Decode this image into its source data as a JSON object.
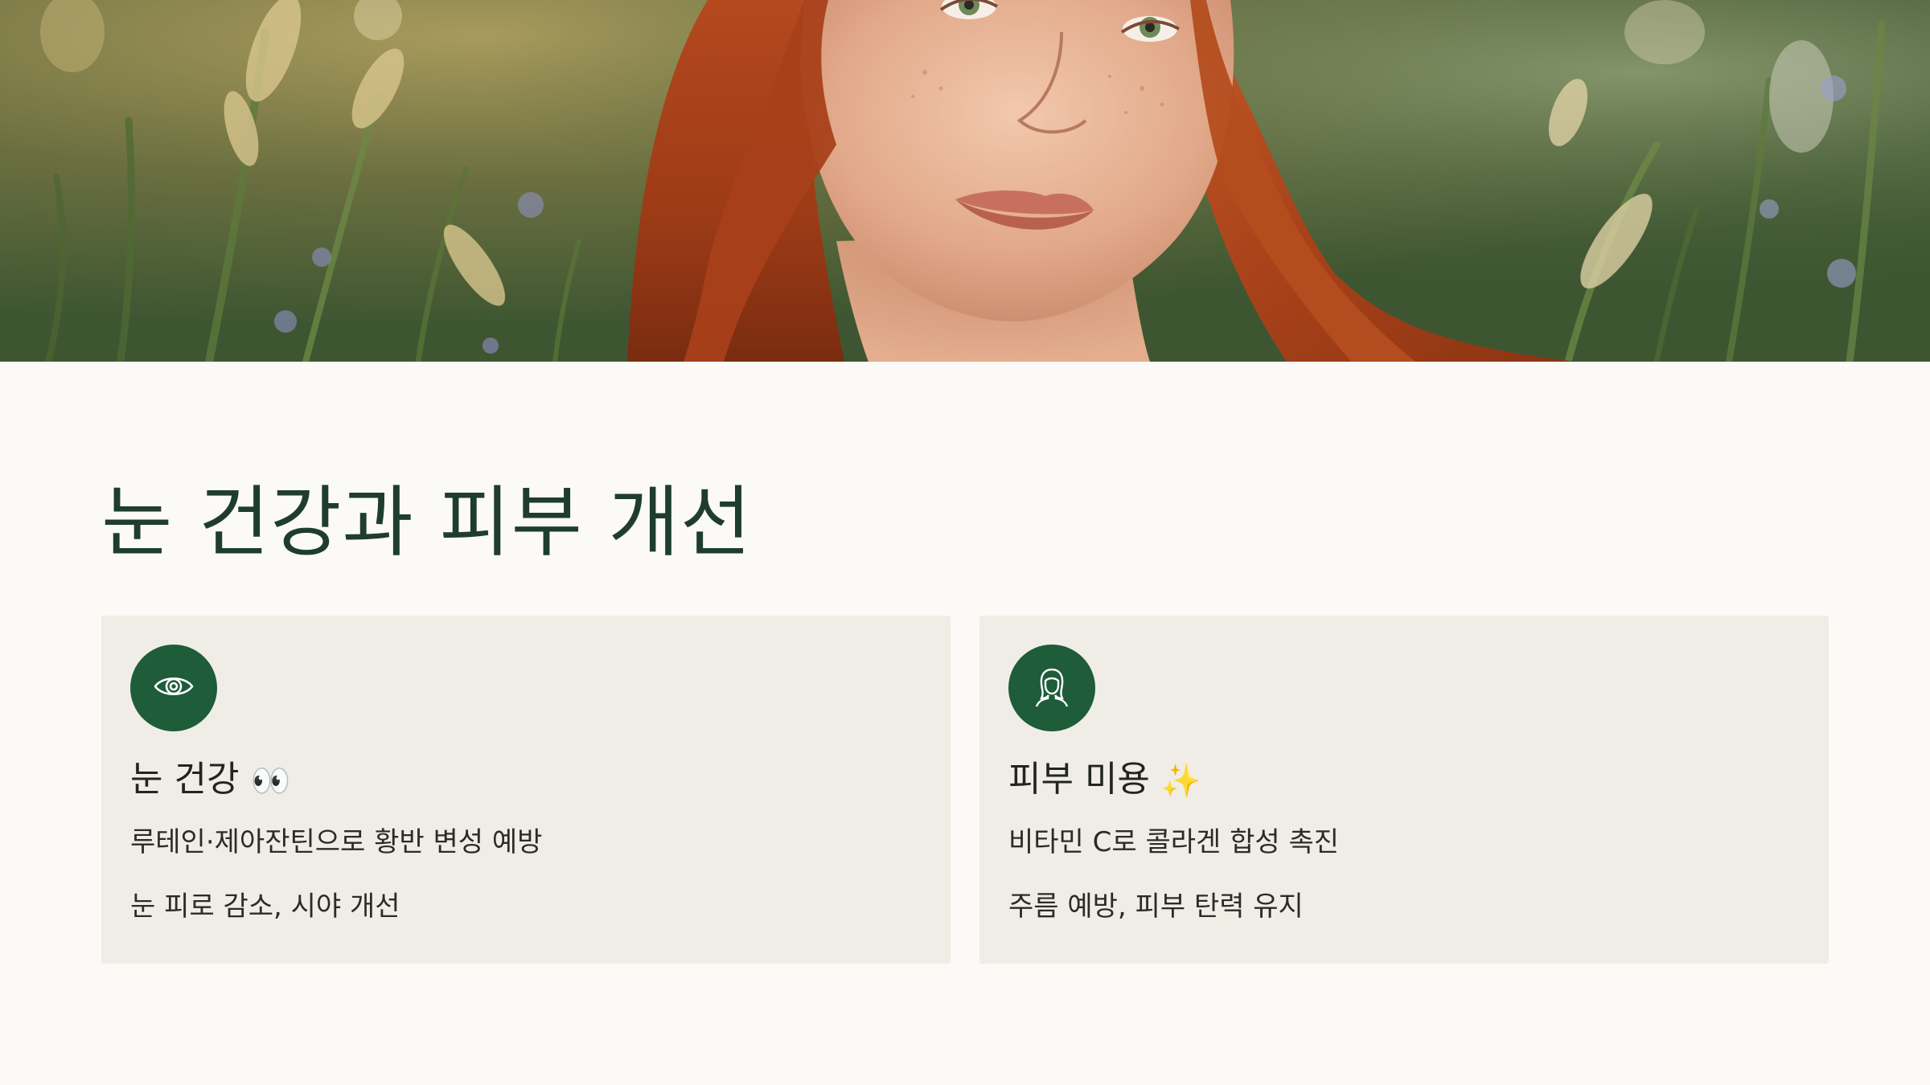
{
  "hero": {
    "image": "portrait-photo"
  },
  "section": {
    "title": "눈 건강과 피부 개선"
  },
  "cards": [
    {
      "icon": "eye-icon",
      "title": "눈 건강",
      "emoji": "👀",
      "lines": [
        "루테인·제아잔틴으로 황반 변성 예방",
        "눈 피로 감소, 시야 개선"
      ]
    },
    {
      "icon": "woman-face-icon",
      "title": "피부 미용",
      "emoji": "✨",
      "lines": [
        "비타민 C로 콜라겐 합성 촉진",
        "주름 예방, 피부 탄력 유지"
      ]
    }
  ],
  "colors": {
    "accent": "#1e5c3a",
    "title": "#1f3d2e",
    "background": "#fbfaf6",
    "card": "#f0ede6"
  }
}
